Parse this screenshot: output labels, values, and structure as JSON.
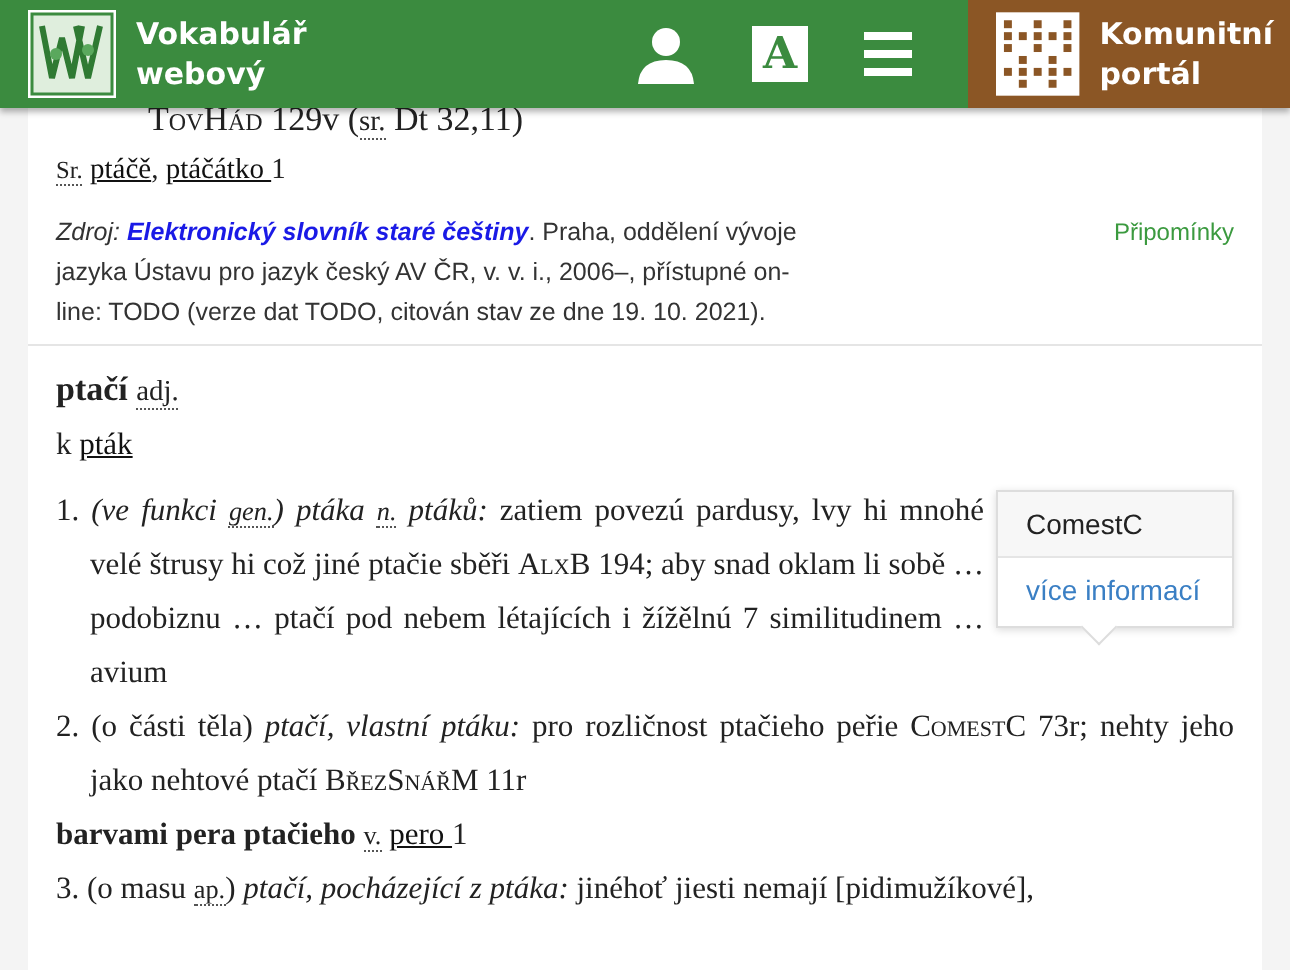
{
  "header": {
    "title": "Vokabulář webový",
    "font_button": "A",
    "portal": "Komunitní portál"
  },
  "top_line": [
    {
      "kind": "siglum",
      "text": "TovHád"
    },
    {
      "kind": "text",
      "text": " 129v ("
    },
    {
      "kind": "abbr",
      "text": "sr."
    },
    {
      "kind": "text",
      "text": " Dt 32,11)"
    }
  ],
  "see_also": [
    {
      "kind": "abbr",
      "text": "Sr."
    },
    {
      "kind": "link",
      "text": "ptáčě",
      "space_before": true
    },
    {
      "kind": "text",
      "text": ", "
    },
    {
      "kind": "link",
      "text": "ptáčátko "
    },
    {
      "kind": "text",
      "text": "1"
    }
  ],
  "citation": {
    "segments": [
      {
        "kind": "italic",
        "text": "Zdroj:"
      },
      {
        "kind": "source",
        "text": "Elektronický slovník staré češtiny",
        "space_before": true
      },
      {
        "kind": "text",
        "text": ". Praha, oddělení vývoje jazyka Ústavu pro jazyk český AV ČR, v. v. i., 2006–, přístupné on-line: TODO (verze dat TODO, citován stav ze dne 19. 10. 2021)."
      }
    ],
    "feedback": "Připomínky"
  },
  "entry": {
    "headword": "ptačí",
    "pos": "adj.",
    "ref": [
      {
        "kind": "text",
        "text": "k "
      },
      {
        "kind": "link",
        "text": "pták"
      }
    ],
    "body": [
      {
        "kind": "sense",
        "number": "1.",
        "segments": [
          {
            "kind": "italic",
            "text": "(ve funkci "
          },
          {
            "kind": "abbr_italic",
            "text": "gen."
          },
          {
            "kind": "italic",
            "text": ") ptáka "
          },
          {
            "kind": "abbr_italic",
            "text": "n."
          },
          {
            "kind": "italic",
            "text": " ptáků:"
          },
          {
            "kind": "text",
            "text": " zatiem povezú pardusy, lvy hi mnohé velé štrusy hi což jiné ptačie sběři "
          },
          {
            "kind": "siglum",
            "text": "AlxB"
          },
          {
            "kind": "text",
            "text": " 194; aby snad oklam li sobě … podobiznu … ptačí pod nebem létajících i žížělnú 7 similitudinem … avium"
          }
        ],
        "popup": {
          "title": "ComestC",
          "link": "více informací"
        }
      },
      {
        "kind": "sense",
        "number": "2.",
        "segments": [
          {
            "kind": "text",
            "text": "(o části těla) "
          },
          {
            "kind": "italic",
            "text": "ptačí, vlastní ptáku:"
          },
          {
            "kind": "text",
            "text": " pro rozličnost ptačieho peřie "
          },
          {
            "kind": "siglum",
            "text": "ComestC"
          },
          {
            "kind": "text",
            "text": " 73r; nehty jeho jako nehtové ptačí "
          },
          {
            "kind": "siglum",
            "text": "BřezSnářM"
          },
          {
            "kind": "text",
            "text": " 11r"
          }
        ]
      },
      {
        "kind": "phrase",
        "segments": [
          {
            "kind": "bold",
            "text": "barvami pera ptačieho"
          },
          {
            "kind": "abbr",
            "text": "v.",
            "space_before": true
          },
          {
            "kind": "link",
            "text": "pero ",
            "space_before": true
          },
          {
            "kind": "text",
            "text": "1"
          }
        ]
      },
      {
        "kind": "sense",
        "number": "3.",
        "segments": [
          {
            "kind": "text",
            "text": "(o masu "
          },
          {
            "kind": "abbr",
            "text": "ap."
          },
          {
            "kind": "text",
            "text": ") "
          },
          {
            "kind": "italic",
            "text": "ptačí, pocházející z ptáka:"
          },
          {
            "kind": "text",
            "text": " jinéhoť jiesti nemají [pidimužíkové],"
          }
        ]
      }
    ]
  }
}
